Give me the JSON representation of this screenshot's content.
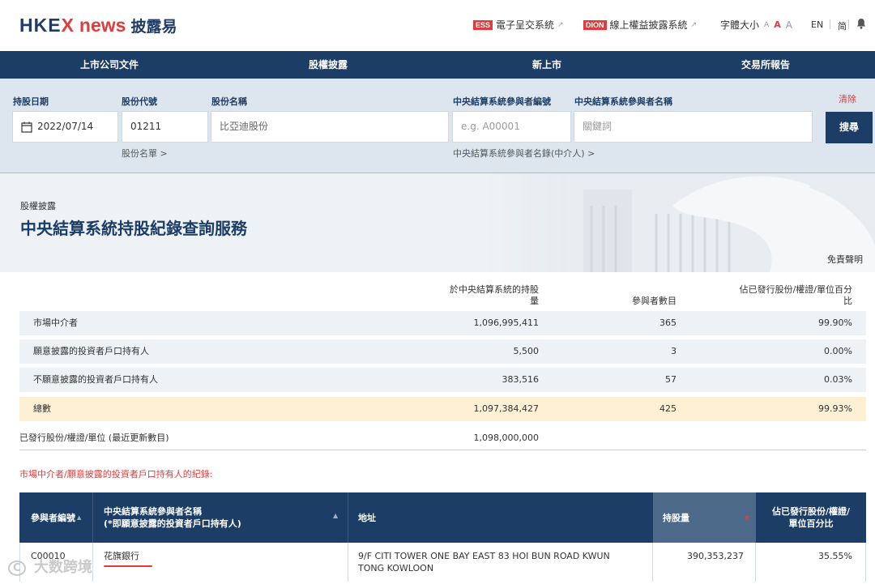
{
  "header": {
    "logo_hkex_a": "HKE",
    "logo_hkex_b": "X",
    "logo_news": "news",
    "logo_cn": "披露易",
    "ess_tag": "ESS",
    "ess_label": "電子呈交系統",
    "dion_tag": "DION",
    "dion_label": "線上權益披露系統",
    "font_size_label": "字體大小",
    "font_a": "A",
    "lang_en": "EN",
    "lang_sc": "简",
    "ext_icon": "↗"
  },
  "nav": [
    "上市公司文件",
    "股權披露",
    "新上市",
    "交易所報告"
  ],
  "search": {
    "date_label": "持股日期",
    "date_value": "2022/07/14",
    "code_label": "股份代號",
    "code_value": "01211",
    "name_label": "股份名稱",
    "name_value": "比亞迪股份",
    "pid_label": "中央結算系統參與者編號",
    "pid_placeholder": "e.g. A00001",
    "pname_label": "中央結算系統參與者名稱",
    "pname_placeholder": "關鍵詞",
    "clear": "清除",
    "search_btn": "搜尋",
    "stock_list_link": "股份名單 >",
    "participant_list_link": "中央結算系統參與者名錄(中介人) >"
  },
  "hero": {
    "kicker": "股權披露",
    "title": "中央結算系統持股紀錄查詢服務",
    "disclaimer": "免責聲明"
  },
  "summary": {
    "col_shareholding_1": "於中央結算系統的持股",
    "col_shareholding_2": "量",
    "col_participants": "參與者數目",
    "col_pct_1": "佔已發行股份/權證/單位百分",
    "col_pct_2": "比",
    "rows": [
      {
        "label": "市場中介者",
        "shares": "1,096,995,411",
        "count": "365",
        "pct": "99.90%"
      },
      {
        "label": "願意披露的投資者戶口持有人",
        "shares": "5,500",
        "count": "3",
        "pct": "0.00%"
      },
      {
        "label": "不願意披露的投資者戶口持有人",
        "shares": "383,516",
        "count": "57",
        "pct": "0.03%"
      },
      {
        "label": "總數",
        "shares": "1,097,384,427",
        "count": "425",
        "pct": "99.93%"
      }
    ],
    "issued_label": "已發行股份/權證/單位 (最近更新數目)",
    "issued_value": "1,098,000,000"
  },
  "records": {
    "section_title": "市場中介者/願意披露的投資者戶口持有人的紀錄:",
    "col_id": "參與者編號",
    "col_name_1": "中央結算系統參與者名稱",
    "col_name_2": "(*即願意披露的投資者戶口持有人)",
    "col_address": "地址",
    "col_shares": "持股量",
    "col_pct_1": "佔已發行股份/權證/",
    "col_pct_2": "單位百分比",
    "sort_up": "▲",
    "sort_down": "▼",
    "rows": [
      {
        "id": "C00010",
        "name": "花旗銀行",
        "address_1": "9/F CITI TOWER ONE BAY EAST 83 HOI BUN ROAD KWUN",
        "address_2": "TONG KOWLOON",
        "shares": "390,353,237",
        "pct": "35.55%"
      }
    ]
  },
  "watermark": "大数跨境",
  "colors": {
    "navy": "#1c3d66",
    "red": "#e23b3b",
    "total_row": "#fdf0d5",
    "row_alt": "#edf2f6"
  }
}
